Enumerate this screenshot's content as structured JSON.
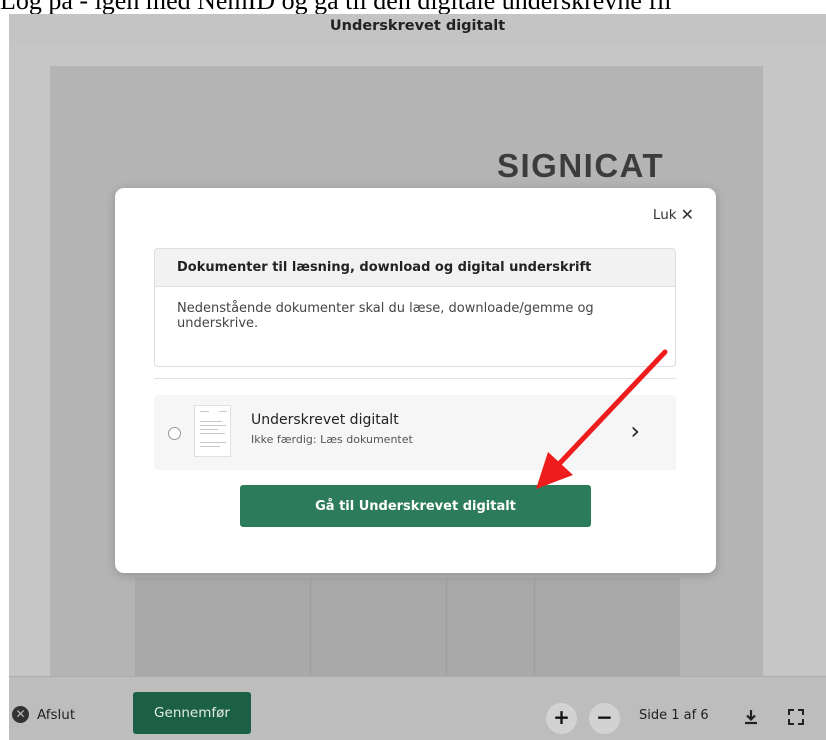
{
  "page_caption": "Log på - igen med NemID og gå til den digitale underskrevne fil",
  "viewer": {
    "title": "Underskrevet digitalt",
    "logo_text": "SIGNICAT"
  },
  "modal": {
    "close_label": "Luk",
    "close_glyph": "✕",
    "section_heading": "Dokumenter til læsning, download og digital underskrift",
    "section_text": "Nedenstående dokumenter skal du læse, downloade/gemme og underskrive.",
    "document": {
      "name": "Underskrevet digitalt",
      "status": "Ikke færdig: Læs dokumentet",
      "chevron_glyph": "›"
    },
    "cta_label": "Gå til Underskrevet digitalt"
  },
  "bottombar": {
    "exit_label": "Afslut",
    "exit_glyph": "✕",
    "complete_label": "Gennemfør",
    "zoom_in_glyph": "+",
    "zoom_out_glyph": "−",
    "page_indicator": "Side 1 af 6"
  },
  "icons": {
    "download": "download-icon",
    "fullscreen": "fullscreen-icon",
    "annotation_arrow": "red-arrow-annotation"
  },
  "colors": {
    "cta_green": "#2c7c5b",
    "dark_green": "#1b5f44",
    "annotation_red": "#ee1c1c"
  }
}
